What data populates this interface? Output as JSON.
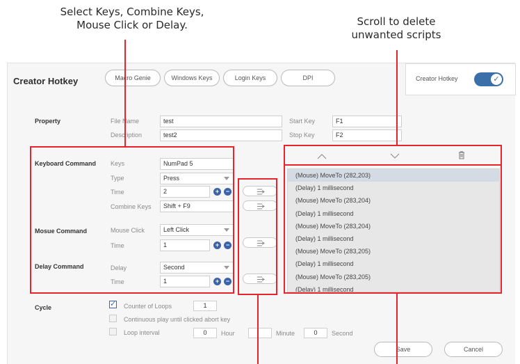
{
  "callouts": {
    "top_left_line1": "Select Keys, Combine Keys,",
    "top_left_line2": "Mouse Click or Delay.",
    "top_right_line1": "Scroll to delete",
    "top_right_line2": "unwanted scripts"
  },
  "app": {
    "title": "Creator Hotkey",
    "tabs": [
      "Macro Genie",
      "Windows Keys",
      "Login Keys",
      "DPI"
    ],
    "toggle": {
      "label": "Creator Hotkey",
      "on": true,
      "color": "#3a6fa8"
    }
  },
  "property": {
    "section": "Property",
    "file_name_label": "File Name",
    "file_name": "test",
    "description_label": "Description",
    "description": "test2",
    "start_key_label": "Start Key",
    "start_key": "F1",
    "stop_key_label": "Stop Key",
    "stop_key": "F2"
  },
  "keyboard": {
    "section": "Keyboard Command",
    "keys_label": "Keys",
    "keys": "NumPad 5",
    "type_label": "Type",
    "type": "Press",
    "time_label": "Time",
    "time": "2",
    "combine_label": "Combine Keys",
    "combine": "Shift + F9"
  },
  "mouse": {
    "section": "Mosue Command",
    "click_label": "Mouse Click",
    "click": "Left Click",
    "time_label": "Time",
    "time": "1"
  },
  "delay": {
    "section": "Delay Command",
    "delay_label": "Delay",
    "delay": "Second",
    "time_label": "Time",
    "time": "1"
  },
  "scripts": {
    "items": [
      "(Mouse) MoveTo (282,203)",
      "(Delay) 1 millisecond",
      "(Mouse) MoveTo (283,204)",
      "(Delay) 1 millisecond",
      "(Mouse) MoveTo (283,204)",
      "(Delay) 1 millisecond",
      "(Mouse) MoveTo (283,205)",
      "(Delay) 1 millisecond",
      "(Mouse) MoveTo (283,205)",
      "(Delay) 1 millisecond"
    ]
  },
  "cycle": {
    "section": "Cycle",
    "counter_label": "Counter of Loops",
    "counter_checked": true,
    "counter_value": "1",
    "continuous_label": "Continuous play until clicked abort key",
    "interval_label": "Loop interval",
    "hour_value": "0",
    "hour_label": "Hour",
    "minute_value": "",
    "minute_label": "Minute",
    "second_value": "0",
    "second_label": "Second"
  },
  "buttons": {
    "save": "Save",
    "cancel": "Cancel"
  },
  "colors": {
    "annotation_red": "#e8232a",
    "accent_blue": "#3b63a9"
  }
}
